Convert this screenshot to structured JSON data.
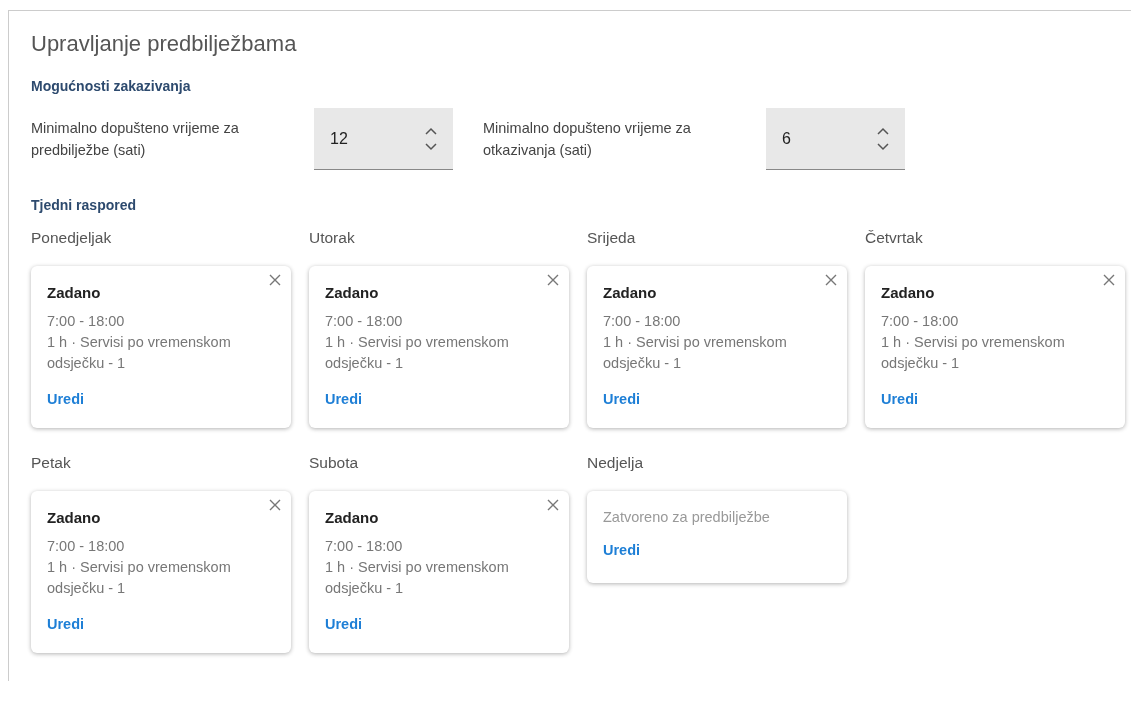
{
  "title": "Upravljanje predbilježbama",
  "options": {
    "heading": "Mogućnosti zakazivanja",
    "fields": [
      {
        "label": "Minimalno dopušteno vrijeme za predbilježbe (sati)",
        "value": "12"
      },
      {
        "label": "Minimalno dopušteno vrijeme za otkazivanja (sati)",
        "value": "6"
      }
    ]
  },
  "schedule": {
    "heading": "Tjedni raspored",
    "days": [
      {
        "day": "Ponedjeljak",
        "kind": "open",
        "name": "Zadano",
        "hours": "7:00 - 18:00",
        "detail": "1 h · Servisi po vremenskom odsječku - 1",
        "action": "Uredi"
      },
      {
        "day": "Utorak",
        "kind": "open",
        "name": "Zadano",
        "hours": "7:00 - 18:00",
        "detail": "1 h · Servisi po vremenskom odsječku - 1",
        "action": "Uredi"
      },
      {
        "day": "Srijeda",
        "kind": "open",
        "name": "Zadano",
        "hours": "7:00 - 18:00",
        "detail": "1 h · Servisi po vremenskom odsječku - 1",
        "action": "Uredi"
      },
      {
        "day": "Četvrtak",
        "kind": "open",
        "name": "Zadano",
        "hours": "7:00 - 18:00",
        "detail": "1 h · Servisi po vremenskom odsječku - 1",
        "action": "Uredi"
      },
      {
        "day": "Petak",
        "kind": "open",
        "name": "Zadano",
        "hours": "7:00 - 18:00",
        "detail": "1 h · Servisi po vremenskom odsječku - 1",
        "action": "Uredi"
      },
      {
        "day": "Subota",
        "kind": "open",
        "name": "Zadano",
        "hours": "7:00 - 18:00",
        "detail": "1 h · Servisi po vremenskom odsječku - 1",
        "action": "Uredi"
      },
      {
        "day": "Nedjelja",
        "kind": "closed",
        "note": "Zatvoreno za predbilježbe",
        "action": "Uredi"
      }
    ]
  }
}
